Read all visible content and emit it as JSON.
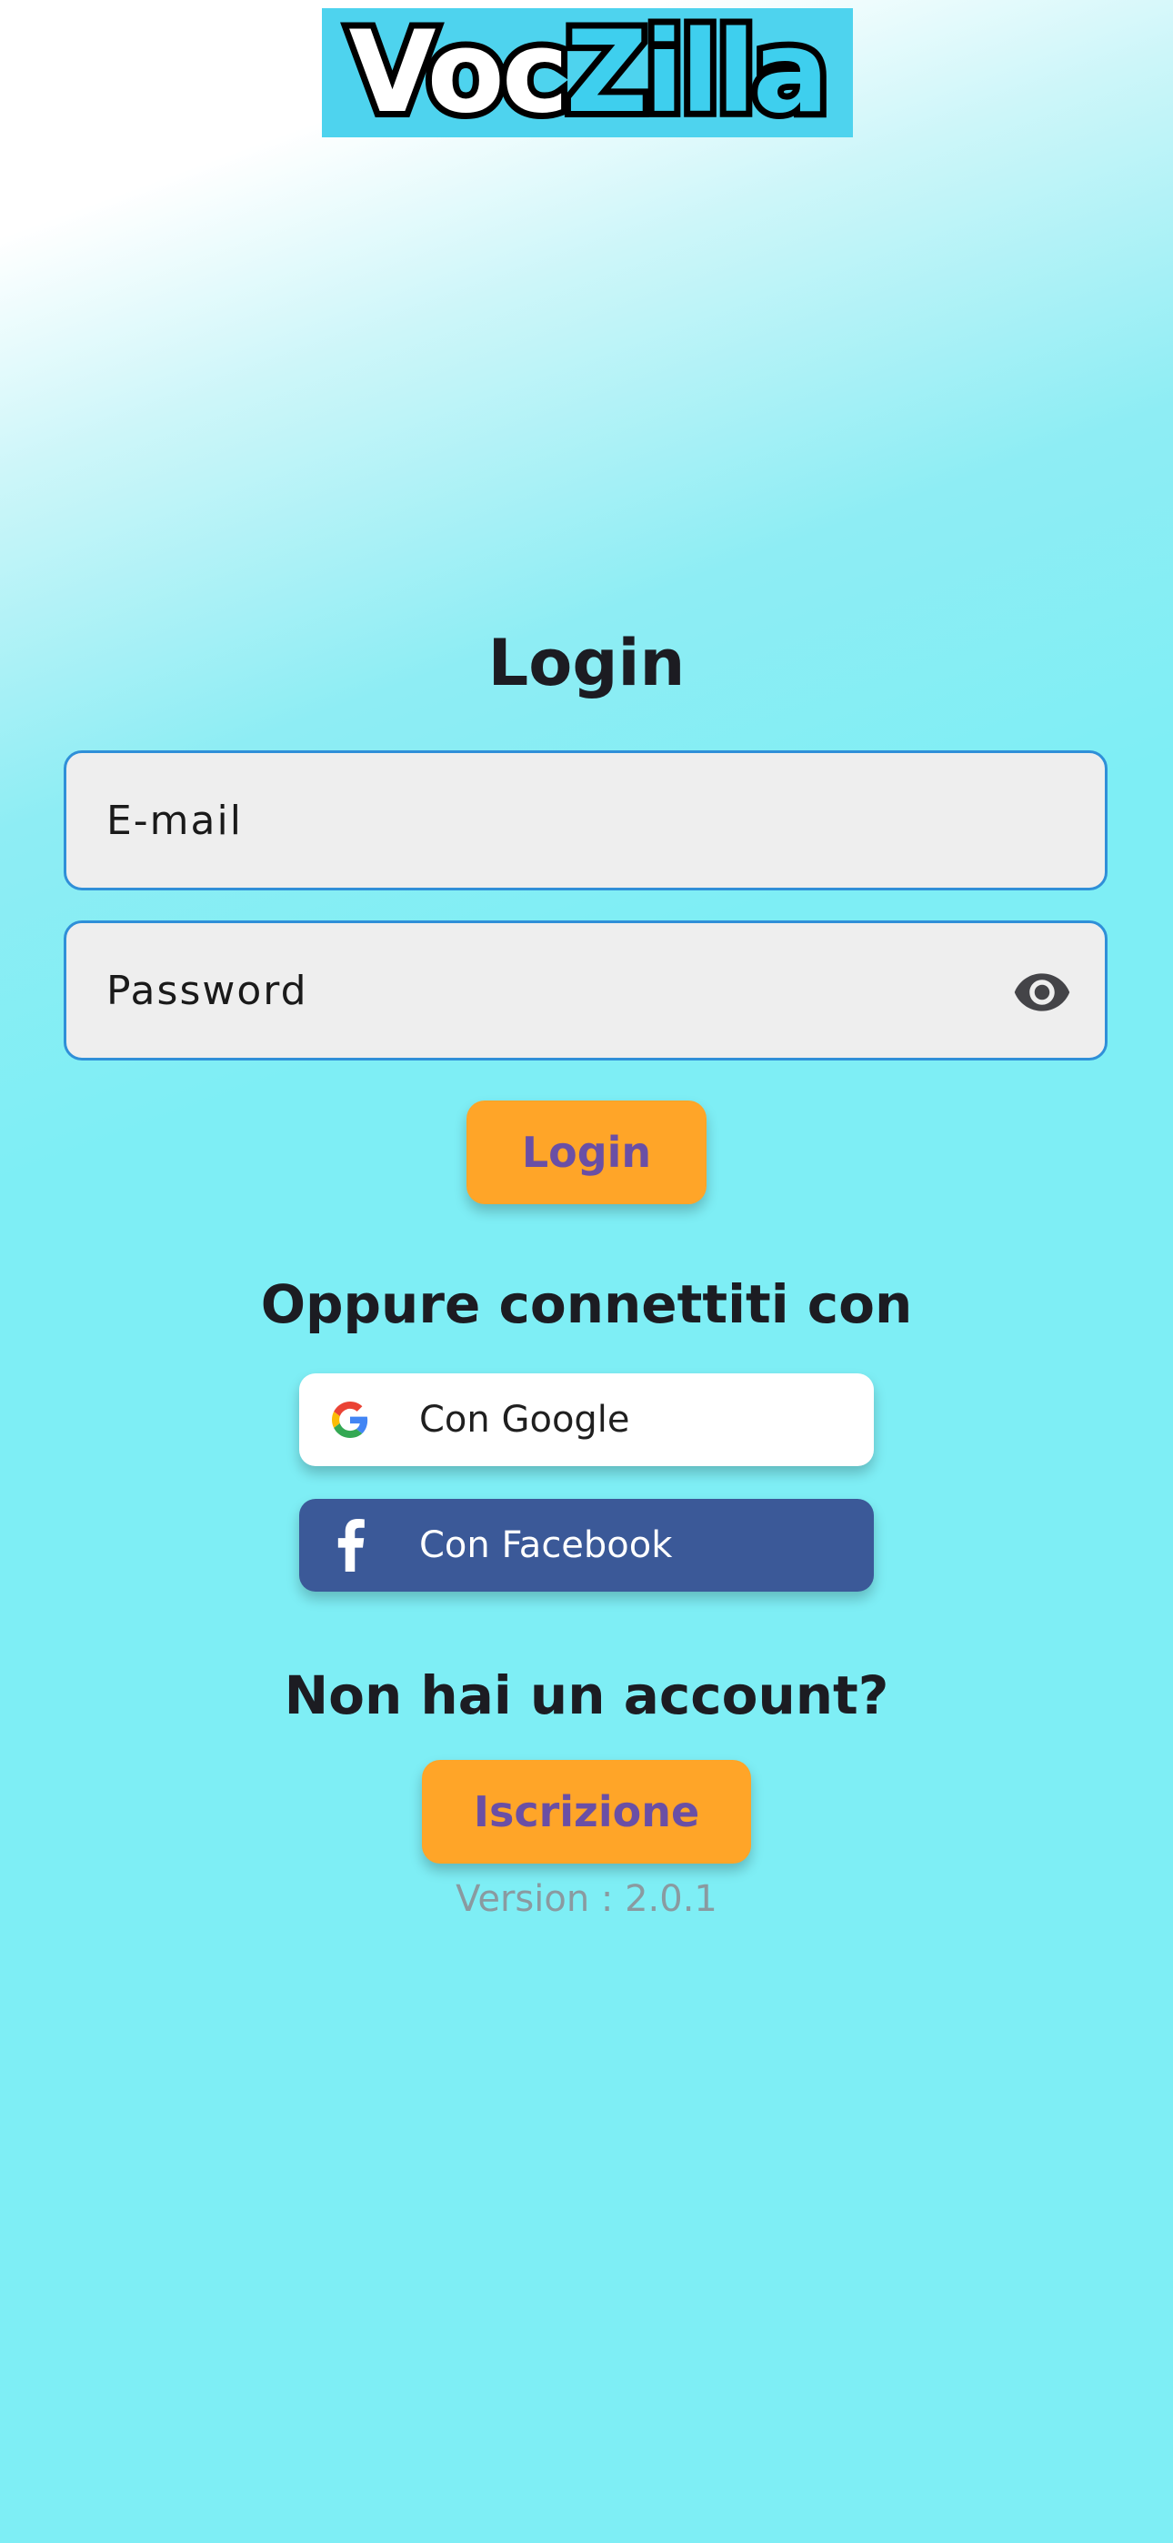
{
  "logo": {
    "part1": "Voc",
    "part2": "Zilla"
  },
  "icons": {
    "back": "arrow-left-icon",
    "eye": "eye-icon",
    "google": "google-logo-icon",
    "facebook": "facebook-logo-icon"
  },
  "colors": {
    "accent_orange": "#ffa528",
    "button_text_purple": "#6a4fa5",
    "field_border_blue": "#2f8fd8",
    "facebook_blue": "#3b5998",
    "background_cyan": "#7eeef5"
  },
  "login": {
    "title": "Login",
    "email_placeholder": "E-mail",
    "password_placeholder": "Password",
    "button_label": "Login"
  },
  "social": {
    "heading": "Oppure connettiti con",
    "google_label": "Con Google",
    "facebook_label": "Con Facebook"
  },
  "signup": {
    "heading": "Non hai un account?",
    "button_label": "Iscrizione"
  },
  "footer": {
    "version": "Version : 2.0.1"
  }
}
